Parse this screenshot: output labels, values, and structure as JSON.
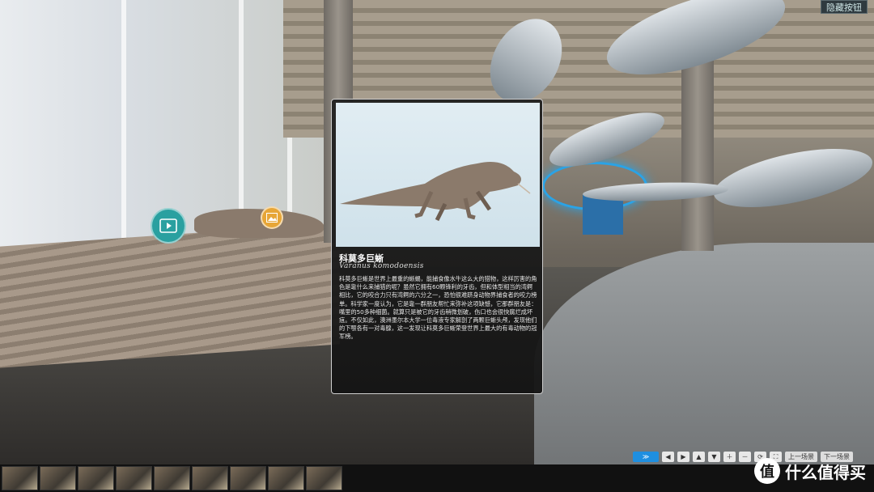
{
  "hide_button": {
    "label": "隐藏按钮"
  },
  "hotspots": [
    {
      "icon": "video-icon",
      "color": "#2aa0a0"
    },
    {
      "icon": "image-icon",
      "color": "#e7a637"
    }
  ],
  "info_card": {
    "title": "科莫多巨蜥",
    "scientific_name": "Varanus komodoensis",
    "description": "科莫多巨蜥是世界上最重的蜥蜴，能捕食像水牛这么大的猎物，这样厉害的角色是靠什么来捕猎的呢？虽然它拥有60颗锋利的牙齿，但和体型相当的湾鳄相比，它的咬合力只有湾鳄的六分之一，恐怕很难跻身动物界捕食者的咬力榜单。科学家一度认为，它是靠一群朋友帮忙来弥补这项缺憾，它那群朋友是：嘴里的50多种细菌。就算只是被它的牙齿稍微划破，伤口也会很快腐烂成坏疽。不仅如此，澳洲墨尔本大学一位毒液专家解剖了两颗巨蜥头颅，发现他们的下颚各有一对毒腺，这一发现让科莫多巨蜥荣登世界上最大的有毒动物的冠军榜。"
  },
  "controls": {
    "collapse": "≫",
    "buttons": [
      "◀",
      "▶",
      "▲",
      "▼",
      "＋",
      "－",
      "⟳",
      "⛶"
    ],
    "prev_scene": "上一场景",
    "next_scene": "下一场景"
  },
  "watermark": {
    "logo": "值",
    "text": "什么值得买"
  },
  "colors": {
    "accent_blue": "#1f8fe0",
    "teal": "#2aa0a0",
    "orange": "#e7a637"
  }
}
